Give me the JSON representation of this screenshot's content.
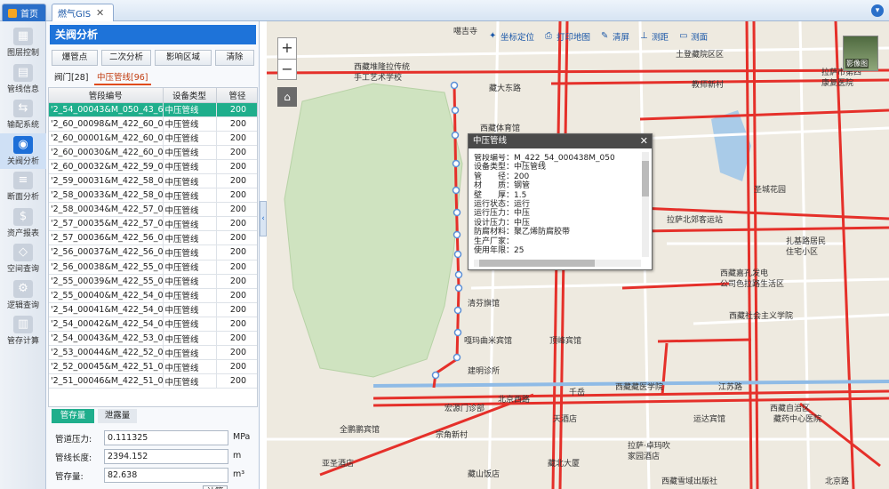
{
  "tabs": {
    "home": "首页",
    "gis": "燃气GIS"
  },
  "rail": [
    {
      "label": "图层控制",
      "icon": "layers-icon",
      "glyph": "▦"
    },
    {
      "label": "管线信息",
      "icon": "pipe-info-icon",
      "glyph": "▤"
    },
    {
      "label": "输配系统",
      "icon": "distribution-icon",
      "glyph": "⇆"
    },
    {
      "label": "关阀分析",
      "icon": "valve-analysis-icon",
      "glyph": "◉"
    },
    {
      "label": "断面分析",
      "icon": "section-analysis-icon",
      "glyph": "≡"
    },
    {
      "label": "资产报表",
      "icon": "asset-report-icon",
      "glyph": "$"
    },
    {
      "label": "空间查询",
      "icon": "spatial-query-icon",
      "glyph": "◇"
    },
    {
      "label": "逻辑查询",
      "icon": "logic-query-icon",
      "glyph": "⚙"
    },
    {
      "label": "管存计算",
      "icon": "pipe-storage-icon",
      "glyph": "▥"
    }
  ],
  "panel": {
    "title": "关阀分析",
    "buttons": [
      "爆管点",
      "二次分析",
      "影响区域",
      "清除"
    ],
    "subtabs": [
      "阀门[28]",
      "中压管线[96]"
    ],
    "columns": [
      "管段编号",
      "设备类型",
      "管径"
    ],
    "rows": [
      [
        "'2_54_00043&M_050_43_6",
        "中压管线",
        "200"
      ],
      [
        "'2_60_00098&M_422_60_0",
        "中压管线",
        "200"
      ],
      [
        "'2_60_00001&M_422_60_0",
        "中压管线",
        "200"
      ],
      [
        "'2_60_00030&M_422_60_0",
        "中压管线",
        "200"
      ],
      [
        "'2_60_00032&M_422_59_0",
        "中压管线",
        "200"
      ],
      [
        "'2_59_00031&M_422_58_0",
        "中压管线",
        "200"
      ],
      [
        "'2_58_00033&M_422_58_0",
        "中压管线",
        "200"
      ],
      [
        "'2_58_00034&M_422_57_0",
        "中压管线",
        "200"
      ],
      [
        "'2_57_00035&M_422_57_0",
        "中压管线",
        "200"
      ],
      [
        "'2_57_00036&M_422_56_0",
        "中压管线",
        "200"
      ],
      [
        "'2_56_00037&M_422_56_0",
        "中压管线",
        "200"
      ],
      [
        "'2_56_00038&M_422_55_0",
        "中压管线",
        "200"
      ],
      [
        "'2_55_00039&M_422_55_0",
        "中压管线",
        "200"
      ],
      [
        "'2_55_00040&M_422_54_0",
        "中压管线",
        "200"
      ],
      [
        "'2_54_00041&M_422_54_0",
        "中压管线",
        "200"
      ],
      [
        "'2_54_00042&M_422_54_0",
        "中压管线",
        "200"
      ],
      [
        "'2_54_00043&M_422_53_0",
        "中压管线",
        "200"
      ],
      [
        "'2_53_00044&M_422_52_0",
        "中压管线",
        "200"
      ],
      [
        "'2_52_00045&M_422_51_0",
        "中压管线",
        "200"
      ],
      [
        "'2_51_00046&M_422_51_0",
        "中压管线",
        "200"
      ]
    ],
    "calc_tabs": [
      "管存量",
      "泄露量"
    ],
    "calc_fields": [
      {
        "label": "管道压力:",
        "value": "0.111325",
        "unit": "MPa"
      },
      {
        "label": "管线长度:",
        "value": "2394.152",
        "unit": "m"
      },
      {
        "label": "管存量:",
        "value": "82.638",
        "unit": "m³"
      }
    ],
    "calc_button": "计算"
  },
  "map": {
    "toolbar": [
      {
        "label": "坐标定位",
        "icon": "locate-icon",
        "glyph": "✦"
      },
      {
        "label": "打印地图",
        "icon": "print-icon",
        "glyph": "⎙"
      },
      {
        "label": "清屏",
        "icon": "clear-icon",
        "glyph": "✎"
      },
      {
        "label": "测距",
        "icon": "measure-distance-icon",
        "glyph": "⊥"
      },
      {
        "label": "测面",
        "icon": "measure-area-icon",
        "glyph": "▭"
      }
    ],
    "thumbnail_label": "影像图",
    "labels": [
      {
        "text": "噶吉寺",
        "name": "label-gajisi"
      },
      {
        "text": "西藏堆隆拉传统",
        "name": "label-xizang-dui"
      },
      {
        "text": "手工艺术学校",
        "name": "label-craft-school"
      },
      {
        "text": "藏大东路",
        "name": "label-zangda-road"
      },
      {
        "text": "土登藏院区区",
        "name": "label-tudeng"
      },
      {
        "text": "拉萨市第四",
        "name": "label-lasa-4"
      },
      {
        "text": "康复医院",
        "name": "label-hospital"
      },
      {
        "text": "教师新村",
        "name": "label-teacher-village"
      },
      {
        "text": "西藏体育馆",
        "name": "label-stadium"
      },
      {
        "text": "圣城花园",
        "name": "label-shengcheng"
      },
      {
        "text": "拉萨北郊客运站",
        "name": "label-bus-station"
      },
      {
        "text": "扎基路居民",
        "name": "label-zhaji"
      },
      {
        "text": "住宅小区",
        "name": "label-residential"
      },
      {
        "text": "西藏嘉孔发电",
        "name": "label-power"
      },
      {
        "text": "公司色拉路生活区",
        "name": "label-life-zone"
      },
      {
        "text": "西藏社会主义学院",
        "name": "label-socialist-college"
      },
      {
        "text": "清芬旗馆",
        "name": "label-qingfen"
      },
      {
        "text": "嘎玛曲米宾馆",
        "name": "label-gama-hotel"
      },
      {
        "text": "顶峰宾馆",
        "name": "label-dingfeng"
      },
      {
        "text": "建明诊所",
        "name": "label-clinic"
      },
      {
        "text": "西藏藏医学院",
        "name": "label-tibetan-med"
      },
      {
        "text": "千岳",
        "name": "label-qianyue"
      },
      {
        "text": "宏源门诊部",
        "name": "label-hongyuan"
      },
      {
        "text": "天酒店",
        "name": "label-hotel-tian"
      },
      {
        "text": "运达宾馆",
        "name": "label-yunda"
      },
      {
        "text": "西藏自治区",
        "name": "label-autonomous"
      },
      {
        "text": "藏药中心医院",
        "name": "label-center-hosp"
      },
      {
        "text": "全鹏鹏宾馆",
        "name": "label-quanpeng"
      },
      {
        "text": "宗角新村",
        "name": "label-zongjiao"
      },
      {
        "text": "拉萨·卓玛吹",
        "name": "label-zhuoma"
      },
      {
        "text": "家园酒店",
        "name": "label-jiayuan"
      },
      {
        "text": "藏北大厦",
        "name": "label-zangbei"
      },
      {
        "text": "西藏雪域出版社",
        "name": "label-press"
      },
      {
        "text": "江苏路",
        "name": "label-jiangsu-rd"
      },
      {
        "text": "北京西路",
        "name": "label-beijing-rd"
      },
      {
        "text": "亚圣酒店",
        "name": "label-yasheng"
      },
      {
        "text": "藏山饭店",
        "name": "label-zangshan"
      },
      {
        "text": "北京路",
        "name": "label-beijing-road"
      }
    ],
    "popup": {
      "title": "中压管线",
      "attributes": [
        "管段编号：M_422_54_000438M_050",
        "设备类型：中压管线",
        "管　　径：200",
        "材　　质：钢管",
        "壁　　厚：1.5",
        "运行状态：运行",
        "运行压力：中压",
        "设计压力：中压",
        "防腐材料：聚乙烯防腐胶带",
        "生产厂家：",
        "使用年限：25"
      ]
    }
  },
  "colors": {
    "accent": "#1e73d9",
    "selected": "#1fae8c",
    "road": "#e5302a",
    "pipe": "#5b8fd6"
  }
}
